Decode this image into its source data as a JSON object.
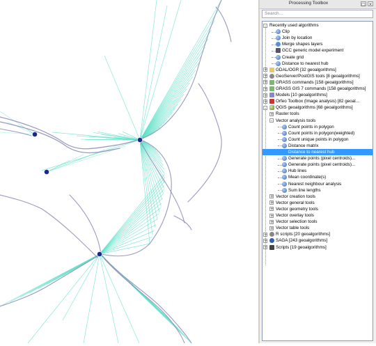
{
  "panel": {
    "title": "Processing Toolbox",
    "btn_float": "□",
    "btn_close": "×",
    "search_placeholder": "Search..."
  },
  "tree": [
    {
      "label": "Recently used algorithms",
      "level": 0,
      "expander": "-",
      "icon": null
    },
    {
      "label": "Clip",
      "level": 1,
      "expander": null,
      "icon": "gear"
    },
    {
      "label": "Join by location",
      "level": 1,
      "expander": null,
      "icon": "gear"
    },
    {
      "label": "Merge shapes layers",
      "level": 1,
      "expander": null,
      "icon": "geo"
    },
    {
      "label": "GCC generic model experiment",
      "level": 1,
      "expander": null,
      "icon": "sq"
    },
    {
      "label": "Create grid",
      "level": 1,
      "expander": null,
      "icon": "gear"
    },
    {
      "label": "Distance to nearest hub",
      "level": 1,
      "expander": null,
      "icon": "gear"
    },
    {
      "label": "GDAL/OGR [32 geoalgorithms]",
      "level": 0,
      "expander": "+",
      "icon": "folder"
    },
    {
      "label": "GeoServer/PostGIS tools [8 geoalgorithms]",
      "level": 0,
      "expander": "+",
      "icon": "gray"
    },
    {
      "label": "GRASS commands [158 geoalgorithms]",
      "level": 0,
      "expander": "+",
      "icon": "grass"
    },
    {
      "label": "GRASS GIS 7 commands [158 geoalgorithms]",
      "level": 0,
      "expander": "+",
      "icon": "grass"
    },
    {
      "label": "Models [10 geoalgorithms]",
      "level": 0,
      "expander": "+",
      "icon": "model"
    },
    {
      "label": "Orfeo Toolbox (Image analysis) [82 geoal...",
      "level": 0,
      "expander": "+",
      "icon": "red"
    },
    {
      "label": "QGIS geoalgorithms [68 geoalgorithms]",
      "level": 0,
      "expander": "-",
      "icon": "qg"
    },
    {
      "label": "Raster tools",
      "level": 1,
      "expander": "+",
      "icon": null
    },
    {
      "label": "Vector analysis tools",
      "level": 1,
      "expander": "-",
      "icon": null
    },
    {
      "label": "Count points in polygon",
      "level": 2,
      "expander": null,
      "icon": "gear"
    },
    {
      "label": "Count points in polygon(weighted)",
      "level": 2,
      "expander": null,
      "icon": "gear"
    },
    {
      "label": "Count unique points in polygon",
      "level": 2,
      "expander": null,
      "icon": "gear"
    },
    {
      "label": "Distance matrix",
      "level": 2,
      "expander": null,
      "icon": "gear"
    },
    {
      "label": "Distance to nearest hub",
      "level": 2,
      "expander": null,
      "icon": "gear",
      "selected": true
    },
    {
      "label": "Generate points (pixel centroids)...",
      "level": 2,
      "expander": null,
      "icon": "gear"
    },
    {
      "label": "Generate points (pixel centroids)...",
      "level": 2,
      "expander": null,
      "icon": "gear"
    },
    {
      "label": "Hub lines",
      "level": 2,
      "expander": null,
      "icon": "gear"
    },
    {
      "label": "Mean coordinate(s)",
      "level": 2,
      "expander": null,
      "icon": "gear"
    },
    {
      "label": "Nearest neighbour analysis",
      "level": 2,
      "expander": null,
      "icon": "gear"
    },
    {
      "label": "Sum line lengths",
      "level": 2,
      "expander": null,
      "icon": "gear"
    },
    {
      "label": "Vector creation tools",
      "level": 1,
      "expander": "+",
      "icon": null
    },
    {
      "label": "Vector general tools",
      "level": 1,
      "expander": "+",
      "icon": null
    },
    {
      "label": "Vector geometry tools",
      "level": 1,
      "expander": "+",
      "icon": null
    },
    {
      "label": "Vector overlay tools",
      "level": 1,
      "expander": "+",
      "icon": null
    },
    {
      "label": "Vector selection tools",
      "level": 1,
      "expander": "+",
      "icon": null
    },
    {
      "label": "Vector table tools",
      "level": 1,
      "expander": "+",
      "icon": null
    },
    {
      "label": "R scripts [20 geoalgorithms]",
      "level": 0,
      "expander": "+",
      "icon": "gray"
    },
    {
      "label": "SAGA [243 geoalgorithms]",
      "level": 0,
      "expander": "+",
      "icon": "saga"
    },
    {
      "label": "Scripts [19 geoalgorithms]",
      "level": 0,
      "expander": "+",
      "icon": "script"
    }
  ],
  "colors": {
    "hub_line": "#5fe0c8",
    "road": "#8f8fb8",
    "hub_point": "#1a2a8a",
    "selection": "#3399ff"
  }
}
